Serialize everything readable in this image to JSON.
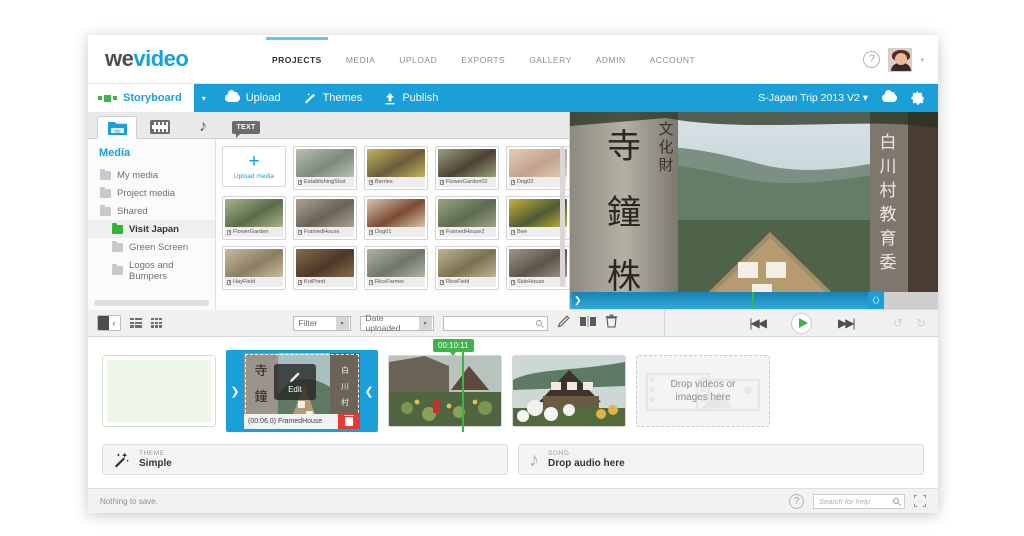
{
  "topnav": {
    "logo": {
      "part1": "we",
      "part2": "vi",
      "part3": "deo"
    },
    "items": [
      {
        "label": "PROJECTS",
        "active": true
      },
      {
        "label": "MEDIA",
        "active": false
      },
      {
        "label": "UPLOAD",
        "active": false
      },
      {
        "label": "EXPORTS",
        "active": false
      },
      {
        "label": "GALLERY",
        "active": false
      },
      {
        "label": "ADMIN",
        "active": false
      },
      {
        "label": "ACCOUNT",
        "active": false
      }
    ],
    "help_glyph": "?",
    "avatar_caret": "▾"
  },
  "toolbar": {
    "storyboard_label": "Storyboard",
    "dropdown_caret": "▾",
    "upload_label": "Upload",
    "themes_label": "Themes",
    "publish_label": "Publish",
    "project_name": "S-Japan Trip 2013 V2 ▾",
    "colors": {
      "blue": "#1b9fd8",
      "green": "#3cb44a",
      "red": "#e43b32"
    }
  },
  "media_panel": {
    "tabs": [
      {
        "name": "media-tab",
        "active": true
      },
      {
        "name": "transitions-tab",
        "active": false
      },
      {
        "name": "audio-tab",
        "active": false
      },
      {
        "name": "text-tab",
        "active": false
      }
    ],
    "text_tab_label": "TEXT",
    "tree_title": "Media",
    "tree": [
      {
        "label": "My media",
        "level": 0,
        "selected": false,
        "green": false
      },
      {
        "label": "Project media",
        "level": 0,
        "selected": false,
        "green": false
      },
      {
        "label": "Shared",
        "level": 0,
        "selected": false,
        "green": false
      },
      {
        "label": "Visit Japan",
        "level": 1,
        "selected": true,
        "green": true
      },
      {
        "label": "Green Screen",
        "level": 1,
        "selected": false,
        "green": false
      },
      {
        "label": "Logos and Bumpers",
        "level": 1,
        "selected": false,
        "green": false
      }
    ],
    "upload_tile": {
      "plus": "+",
      "label": "Upload media"
    },
    "items": [
      {
        "label": "EstablishingShot",
        "color1": "#7d8a7a",
        "color2": "#b9c0b4"
      },
      {
        "label": "Berries",
        "color1": "#6a5d3a",
        "color2": "#c2b45e"
      },
      {
        "label": "FlowerGarden02",
        "color1": "#4e4034",
        "color2": "#96a27c"
      },
      {
        "label": "Dog02",
        "color1": "#c2a28c",
        "color2": "#e3cdb8"
      },
      {
        "label": "FlowerGarden",
        "color1": "#5b6b4a",
        "color2": "#a8b48c"
      },
      {
        "label": "FramedHouse",
        "color1": "#6b6256",
        "color2": "#aba193"
      },
      {
        "label": "Dog01",
        "color1": "#7b4a30",
        "color2": "#d8c6b4"
      },
      {
        "label": "FramedHouse2",
        "color1": "#5d6a4e",
        "color2": "#9aa583"
      },
      {
        "label": "Bee",
        "color1": "#4d5a34",
        "color2": "#c8b33c"
      },
      {
        "label": "HayField",
        "color1": "#8a7d62",
        "color2": "#c9bda0"
      },
      {
        "label": "KoiPond",
        "color1": "#4a3828",
        "color2": "#8a6b4a"
      },
      {
        "label": "RiceFarmer",
        "color1": "#6d7668",
        "color2": "#aeb5a6"
      },
      {
        "label": "RiceField",
        "color1": "#7a7152",
        "color2": "#c0b58e"
      },
      {
        "label": "SideHouse",
        "color1": "#5c5448",
        "color2": "#9f9687"
      }
    ]
  },
  "control_bar": {
    "filter_placeholder": "Filter",
    "sort_value": "Date uploaded",
    "search_value": "",
    "dropdown_arrow": "▾",
    "prev_glyph": "|◀◀",
    "next_glyph": "▶▶|",
    "undo_glyph": "↺",
    "redo_glyph": "↻"
  },
  "storyboard": {
    "playhead_time": "00:10:11",
    "selected_clip": {
      "caption": "(00:06.0) FramedHouse",
      "edit_label": "Edit",
      "left_arrow": "❯",
      "right_arrow": "❮"
    },
    "dropzone_text_line1": "Drop videos or",
    "dropzone_text_line2": "images here"
  },
  "theme_song": {
    "theme_label": "THEME",
    "theme_value": "Simple",
    "song_label": "SONG",
    "song_value": "Drop audio here"
  },
  "statusbar": {
    "message": "Nothing to save.",
    "help_glyph": "?",
    "help_search_placeholder": "Search for help"
  }
}
